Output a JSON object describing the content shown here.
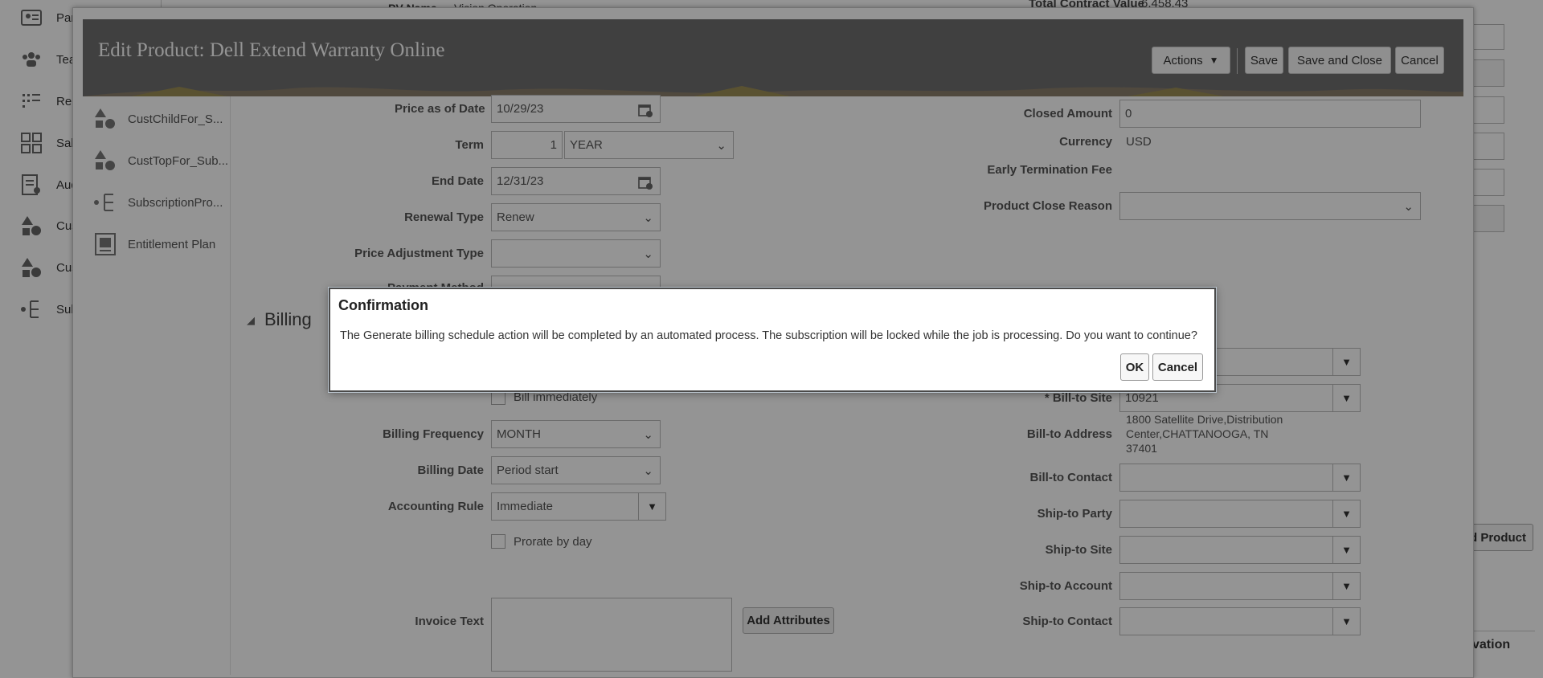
{
  "background": {
    "nav_items": [
      {
        "label": "Par",
        "icon": "profile-card-icon"
      },
      {
        "label": "Tea",
        "icon": "team-icon"
      },
      {
        "label": "Ren",
        "icon": "renewal-list-icon"
      },
      {
        "label": "Sale",
        "icon": "sales-grid-icon"
      },
      {
        "label": "Aud",
        "icon": "audit-icon"
      },
      {
        "label": "Cus",
        "icon": "shapes-icon"
      },
      {
        "label": "Cus",
        "icon": "shapes-icon"
      },
      {
        "label": "Sub",
        "icon": "hierarchy-icon"
      }
    ],
    "top_label_1": "PV Name",
    "top_value_1": "Vision Operation",
    "top_label_2": "Total Contract Value",
    "top_value_2": "6,458.43",
    "right_button": "d Product",
    "right_heading": "vation"
  },
  "modal": {
    "title": "Edit Product: Dell Extend Warranty Online",
    "actions_label": "Actions",
    "save_label": "Save",
    "save_close_label": "Save and Close",
    "cancel_label": "Cancel",
    "left_items": [
      {
        "label": "CustChildFor_S...",
        "icon": "shapes-icon"
      },
      {
        "label": "CustTopFor_Sub...",
        "icon": "shapes-icon"
      },
      {
        "label": "SubscriptionPro...",
        "icon": "hierarchy-icon"
      },
      {
        "label": "Entitlement Plan",
        "icon": "plan-icon"
      }
    ],
    "form": {
      "price_as_of_date_label": "Price as of Date",
      "price_as_of_date": "10/29/23",
      "term_label": "Term",
      "term_value": "1",
      "term_unit": "YEAR",
      "end_date_label": "End Date",
      "end_date": "12/31/23",
      "renewal_type_label": "Renewal Type",
      "renewal_type": "Renew",
      "price_adjustment_label": "Price Adjustment Type",
      "price_adjustment": "",
      "payment_method_label": "Payment Method",
      "closed_amount_label": "Closed Amount",
      "closed_amount": "0",
      "currency_label": "Currency",
      "currency": "USD",
      "early_termination_label": "Early Termination Fee",
      "close_reason_label": "Product Close Reason",
      "close_reason": ""
    },
    "billing": {
      "section_title": "Billing",
      "bill_immediately_label": "Bill immediately",
      "billing_frequency_label": "Billing Frequency",
      "billing_frequency": "MONTH",
      "billing_date_label": "Billing Date",
      "billing_date": "Period start",
      "accounting_rule_label": "Accounting Rule",
      "accounting_rule": "Immediate",
      "prorate_label": "Prorate by day",
      "invoice_text_label": "Invoice Text",
      "add_attributes_label": "Add Attributes",
      "bill_to_site_label": "* Bill-to Site",
      "bill_to_site": "10921",
      "bill_to_address_label": "Bill-to Address",
      "bill_to_address_line1": "1800 Satellite Drive,Distribution",
      "bill_to_address_line2": "Center,CHATTANOOGA, TN",
      "bill_to_address_line3": "37401",
      "bill_to_contact_label": "Bill-to Contact",
      "ship_to_party_label": "Ship-to Party",
      "ship_to_site_label": "Ship-to Site",
      "ship_to_account_label": "Ship-to Account",
      "ship_to_contact_label": "Ship-to Contact"
    }
  },
  "dialog": {
    "title": "Confirmation",
    "message": "The Generate billing schedule action will be completed by an automated process. The subscription will be locked while the job is processing. Do you want to continue?",
    "ok_label": "OK",
    "cancel_label": "Cancel"
  }
}
